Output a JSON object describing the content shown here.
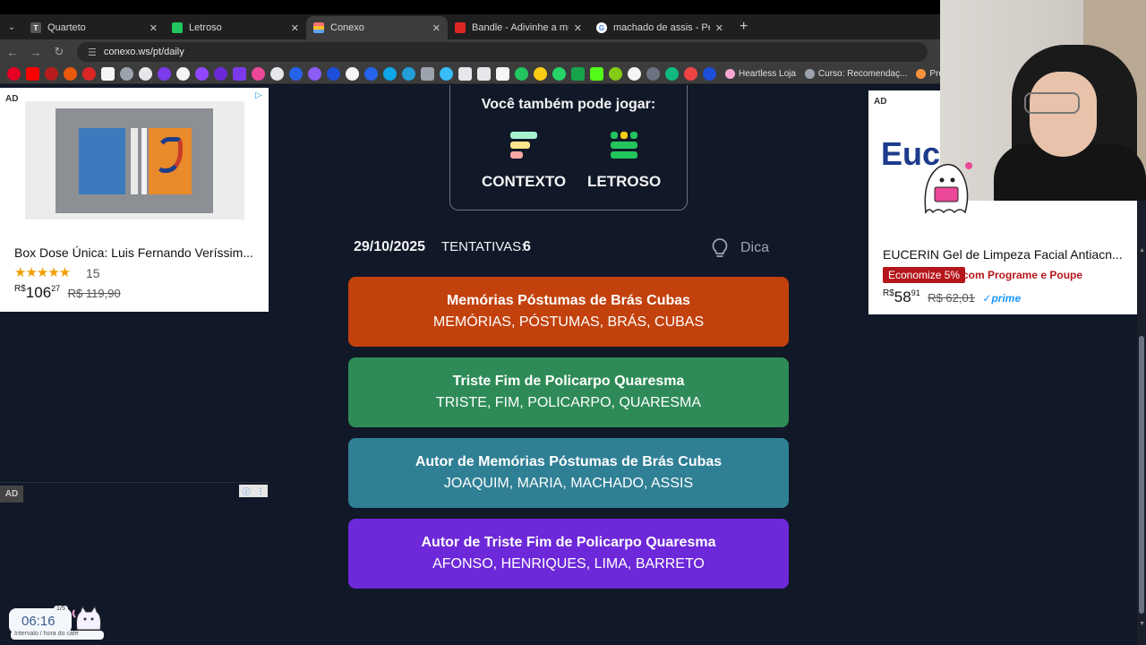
{
  "browser": {
    "tabs": [
      {
        "label": "Quarteto",
        "icon": "quarteto-favicon",
        "color": "#555555",
        "active": false
      },
      {
        "label": "Letroso",
        "icon": "letroso-favicon",
        "color": "#22c55e",
        "active": false
      },
      {
        "label": "Conexo",
        "icon": "conexo-favicon",
        "color": "#3b82f6",
        "active": true
      },
      {
        "label": "Bandle - Adivinhe a música, um",
        "icon": "bandle-favicon",
        "color": "#dc2626",
        "active": false
      },
      {
        "label": "machado de assis - Pesquisa Go",
        "icon": "google-favicon",
        "color": "#ffffff",
        "active": false
      }
    ],
    "url": "conexo.ws/pt/daily",
    "bookmarks": [
      {
        "label": "Heartless Loja",
        "icon": "heart-icon"
      },
      {
        "label": "Curso: Recomendaç...",
        "icon": "course-icon"
      },
      {
        "label": "Probl",
        "icon": "probl-icon"
      }
    ]
  },
  "ads": {
    "left": {
      "tag": "AD",
      "title": "Box Dose Única: Luis Fernando Veríssim...",
      "stars": "★★★★★",
      "rating_count": "15",
      "price_currency": "R$",
      "price_whole": "106",
      "price_cents": "27",
      "price_old": "R$ 119,90"
    },
    "left2": {
      "tag": "AD"
    },
    "right": {
      "tag": "AD",
      "brand": "Euce",
      "title": "EUCERIN Gel de Limpeza Facial Antiacn...",
      "badge": "Economize 5%",
      "save_text": "com Programe e Poupe",
      "price_currency": "R$",
      "price_whole": "58",
      "price_cents": "91",
      "price_old": "R$ 62,01",
      "prime": "✓prime"
    }
  },
  "promo": {
    "title": "Você também pode jogar:",
    "games": [
      {
        "label": "CONTEXTO",
        "icon": "contexto-icon"
      },
      {
        "label": "LETROSO",
        "icon": "letroso-icon"
      }
    ]
  },
  "status": {
    "date": "29/10/2025",
    "tries_label": "TENTATIVAS:",
    "tries": "6",
    "hint": "Dica"
  },
  "groups": [
    {
      "title": "Memórias Póstumas de Brás Cubas",
      "words": "MEMÓRIAS, PÓSTUMAS, BRÁS, CUBAS",
      "color": "#c2410c"
    },
    {
      "title": "Triste Fim de Policarpo Quaresma",
      "words": "TRISTE, FIM, POLICARPO, QUARESMA",
      "color": "#2e8b57"
    },
    {
      "title": "Autor de Memórias Póstumas de Brás Cubas",
      "words": "JOAQUIM, MARIA, MACHADO, ASSIS",
      "color": "#2f7f95"
    },
    {
      "title": "Autor de Triste Fim de Policarpo Quaresma",
      "words": "AFONSO, HENRIQUES, LIMA, BARRETO",
      "color": "#6d28d9"
    }
  ],
  "timer": {
    "time": "06:16",
    "fraction": "1/5",
    "label": "Intervalo / hora do café"
  }
}
